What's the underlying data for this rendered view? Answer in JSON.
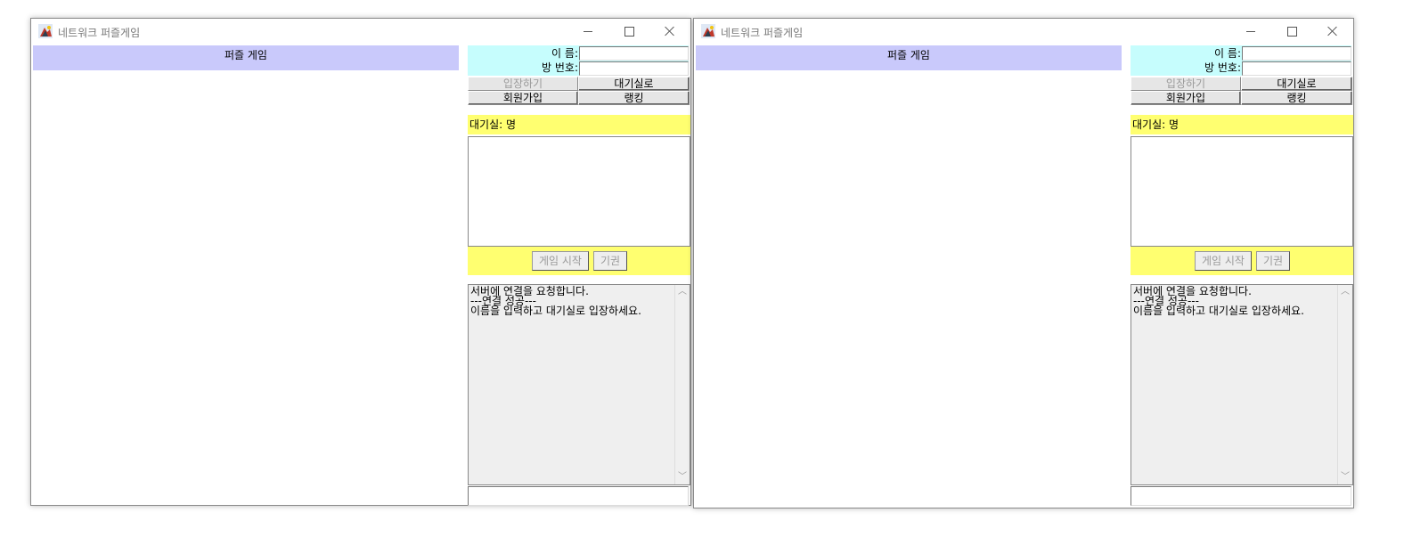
{
  "windows": [
    {
      "title": "네트워크 퍼즐게임",
      "game_header": "퍼즐 게임",
      "login": {
        "name_label": "이   름:",
        "room_label": "방 번호:",
        "name_value": "",
        "room_value": ""
      },
      "buttons": {
        "enter": "입장하기",
        "lobby": "대기실로",
        "signup": "회원가입",
        "ranking": "랭킹"
      },
      "waiting_label": "대기실: 명",
      "actions": {
        "start": "게임 시작",
        "forfeit": "기권"
      },
      "log": "서버에 연결을 요청합니다.\n---연결 성공---\n이름을 입력하고 대기실로 입장하세요.",
      "chat_input": ""
    },
    {
      "title": "네트워크 퍼즐게임",
      "game_header": "퍼즐 게임",
      "login": {
        "name_label": "이   름:",
        "room_label": "방 번호:",
        "name_value": "",
        "room_value": ""
      },
      "buttons": {
        "enter": "입장하기",
        "lobby": "대기실로",
        "signup": "회원가입",
        "ranking": "랭킹"
      },
      "waiting_label": "대기실: 명",
      "actions": {
        "start": "게임 시작",
        "forfeit": "기권"
      },
      "log": "서버에 연결을 요청합니다.\n---연결 성공---\n이름을 입력하고 대기실로 입장하세요.",
      "chat_input": ""
    }
  ],
  "icons": {
    "app": "java-duke-icon",
    "minimize": "minimize-icon",
    "maximize": "maximize-icon",
    "close": "close-icon"
  },
  "colors": {
    "game_header": "#c9c9fb",
    "login_panel": "#c6fdfd",
    "waiting_bar": "#ffff70",
    "log_background": "#efefef"
  }
}
